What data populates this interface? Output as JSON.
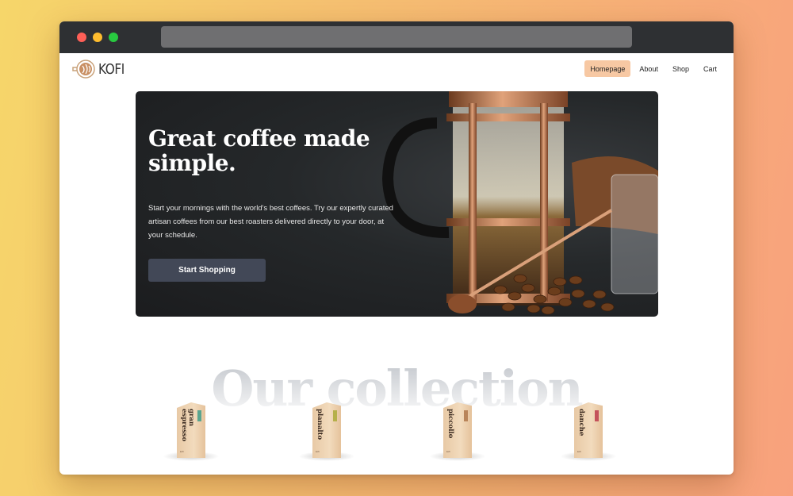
{
  "browser": {
    "url": ""
  },
  "nav": {
    "logo_text": "KOFI",
    "items": [
      {
        "label": "Homepage",
        "active": true
      },
      {
        "label": "About",
        "active": false
      },
      {
        "label": "Shop",
        "active": false
      },
      {
        "label": "Cart",
        "active": false
      }
    ]
  },
  "hero": {
    "title": "Great coffee made simple.",
    "description": "Start your mornings with the world's best coffees. Try our expertly curated artisan coffees from our best roasters delivered directly to your door, at your schedule.",
    "cta_label": "Start Shopping"
  },
  "collection": {
    "heading": "Our collection",
    "products": [
      {
        "name": "gran espresso",
        "tag_color": "#5aa58f"
      },
      {
        "name": "planalto",
        "tag_color": "#b6b04a"
      },
      {
        "name": "piccollo",
        "tag_color": "#b9855a"
      },
      {
        "name": "danche",
        "tag_color": "#c4525b"
      }
    ],
    "brand_label": "kofi"
  },
  "colors": {
    "accent": "#f7c8a3",
    "button": "#424857",
    "hero_bg": "#1f2123"
  }
}
